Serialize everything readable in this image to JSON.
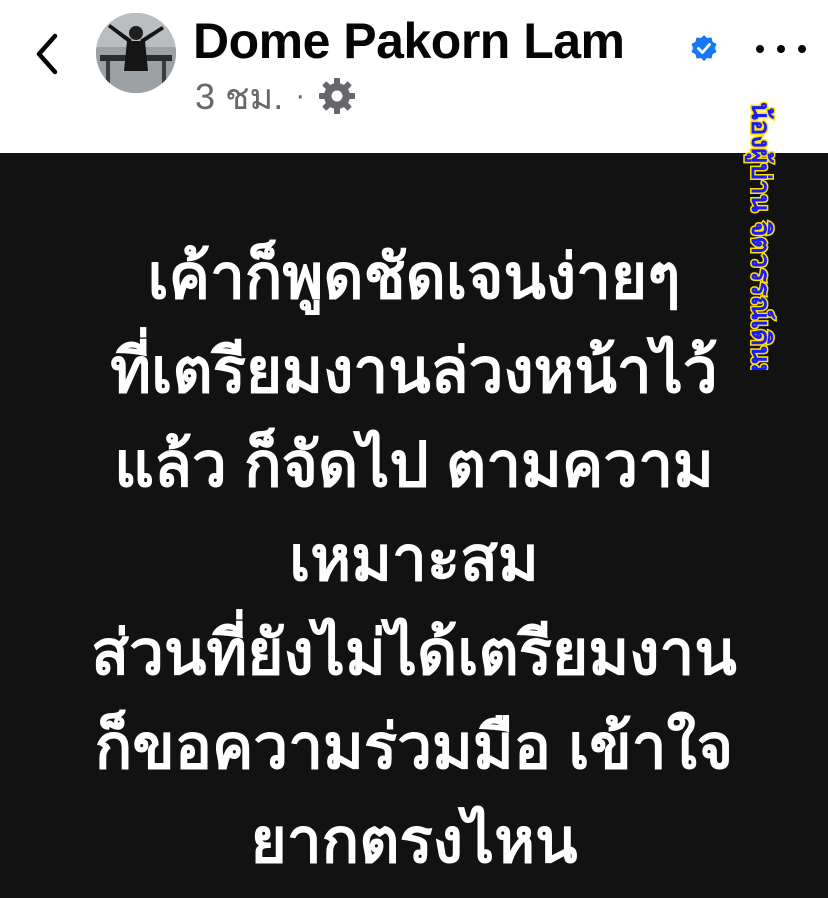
{
  "header": {
    "back_icon": "chevron-left-icon",
    "author_name": "Dome Pakorn Lam",
    "verified_icon": "verified-badge-icon",
    "timestamp": "3 ชม.",
    "separator": "·",
    "audience_icon": "gear-icon",
    "more_icon": "more-horizontal-icon"
  },
  "watermark": {
    "text": "น้องผู้บ่าน จิตวรรณ์เดินมารธ",
    "color": "#1a1aff",
    "outline": "#ffe100"
  },
  "post": {
    "background": "#121212",
    "text_color": "#ffffff",
    "lines": [
      "เค้าก็พูดชัดเจนง่ายๆ",
      "ที่เตรียมงานล่วงหน้าไว้",
      "แล้ว ก็จัดไป ตามความ",
      "เหมาะสม",
      "ส่วนที่ยังไม่ได้เตรียมงาน",
      "ก็ขอความร่วมมือ เข้าใจ",
      "ยากตรงไหน"
    ]
  },
  "colors": {
    "verified": "#1877f2",
    "meta_text": "#65676b",
    "name_text": "#050505"
  }
}
